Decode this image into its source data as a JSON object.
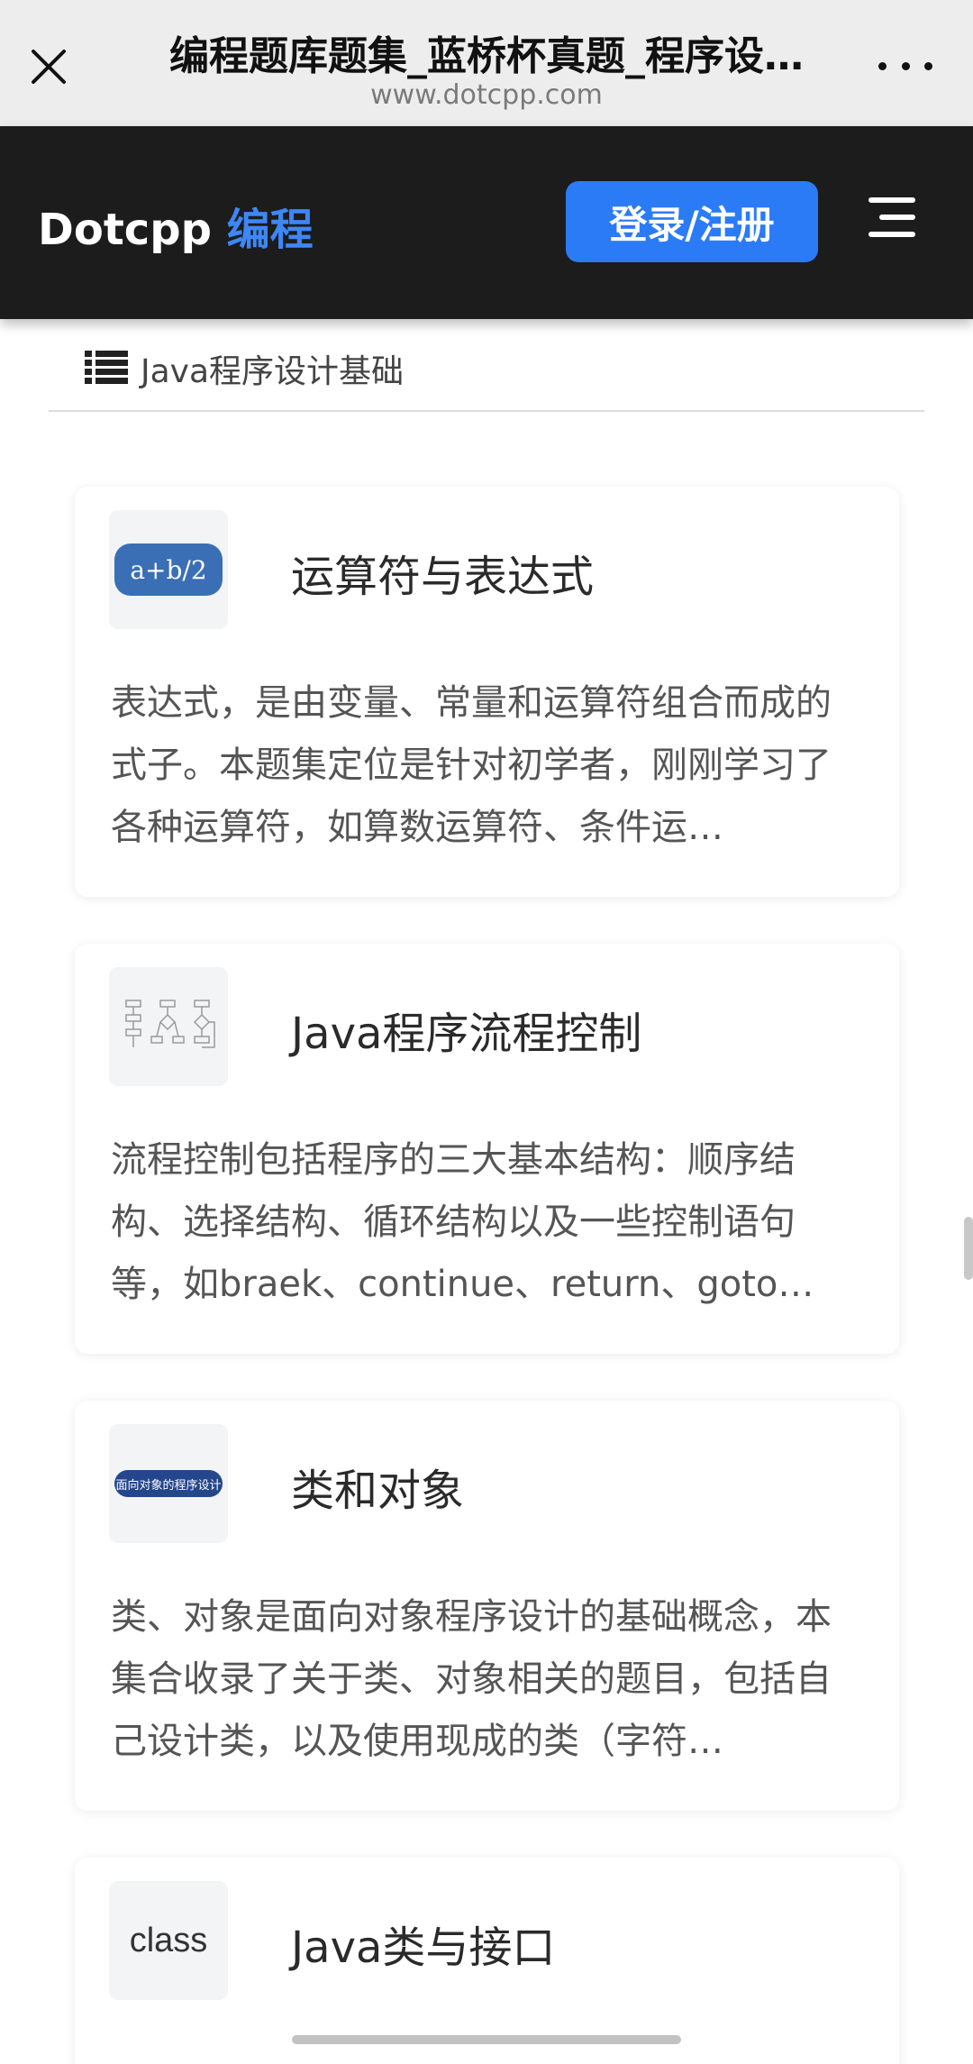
{
  "browser": {
    "title": "编程题库题集_蓝桥杯真题_程序设…",
    "url": "www.dotcpp.com"
  },
  "header": {
    "logo_main": "Dotcpp ",
    "logo_accent": "编程",
    "login_label": "登录/注册"
  },
  "breadcrumb": {
    "label": "Java程序设计基础"
  },
  "cards": [
    {
      "thumb_text": "a+b/2",
      "title": "运算符与表达式",
      "desc": "表达式，是由变量、常量和运算符组合而成的式子。本题集定位是针对初学者，刚刚学习了各种运算符，如算数运算符、条件运…"
    },
    {
      "thumb_text": "",
      "title": "Java程序流程控制",
      "desc": "流程控制包括程序的三大基本结构：顺序结构、选择结构、循环结构以及一些控制语句等，如braek、continue、return、goto…"
    },
    {
      "thumb_text": "面向对象的程序设计",
      "title": "类和对象",
      "desc": "类、对象是面向对象程序设计的基础概念，本集合收录了关于类、对象相关的题目，包括自己设计类，以及使用现成的类（字符…"
    },
    {
      "thumb_text": "class",
      "title": "Java类与接口",
      "desc": ""
    }
  ],
  "colors": {
    "header_bg": "#1c1c1c",
    "accent": "#2b7bf6"
  }
}
